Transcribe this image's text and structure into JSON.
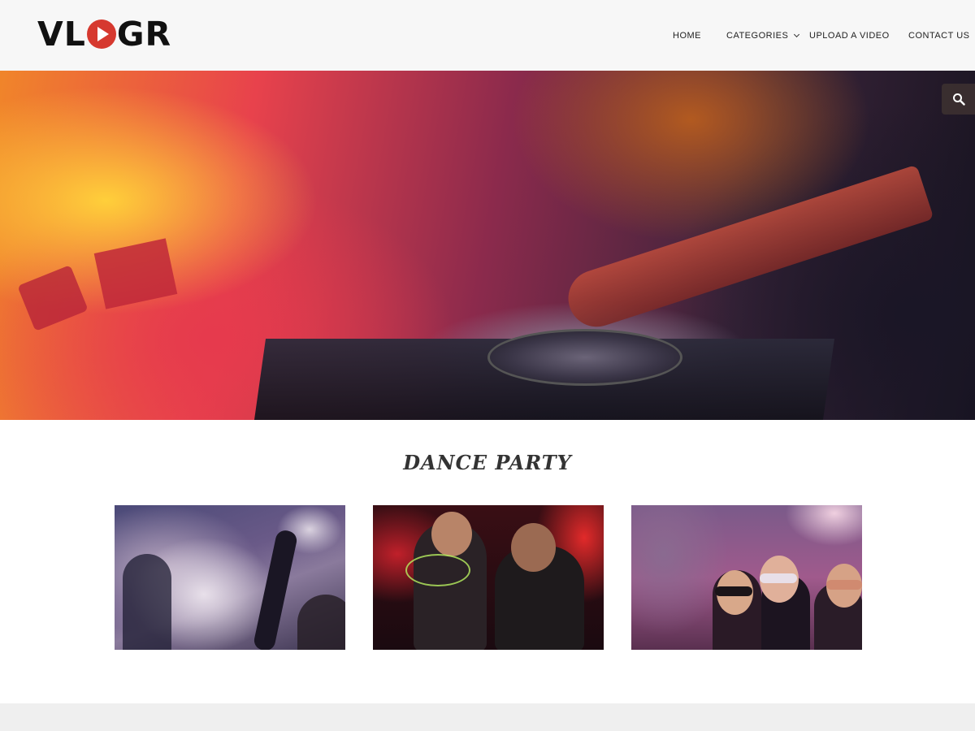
{
  "header": {
    "logo": {
      "prefix": "VL",
      "suffix": "GR",
      "play_color": "#d6392f"
    },
    "nav": {
      "home": "HOME",
      "categories": "CATEGORIES",
      "upload": "UPLOAD A VIDEO",
      "contact": "CONTACT US"
    }
  },
  "hero": {
    "search_icon": "search-icon"
  },
  "section": {
    "title": "DANCE PARTY"
  },
  "videos": [
    {
      "icon": "video-thumbnail"
    },
    {
      "icon": "video-thumbnail"
    },
    {
      "icon": "video-thumbnail"
    }
  ],
  "colors": {
    "accent": "#d6392f",
    "header_bg": "#f7f7f7",
    "footer_bg": "#efefef"
  }
}
